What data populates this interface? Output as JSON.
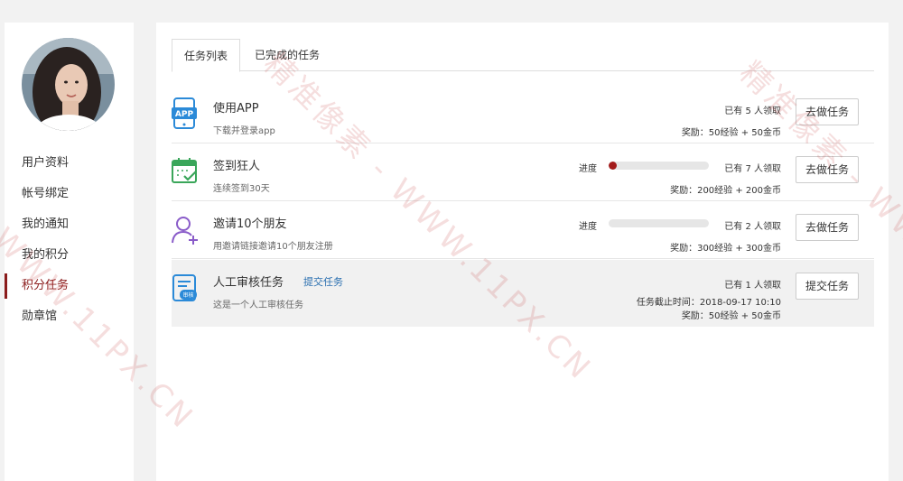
{
  "sidebar": {
    "items": [
      {
        "label": "用户资料"
      },
      {
        "label": "帐号绑定"
      },
      {
        "label": "我的通知"
      },
      {
        "label": "我的积分"
      },
      {
        "label": "积分任务"
      },
      {
        "label": "勋章馆"
      }
    ],
    "active_index": 4
  },
  "tabs": [
    {
      "label": "任务列表"
    },
    {
      "label": "已完成的任务"
    }
  ],
  "tasks": [
    {
      "icon": "app-icon",
      "title": "使用APP",
      "desc": "下载并登录app",
      "claimed": "已有 5 人领取",
      "reward": "奖励：50经验 + 50金币",
      "button": "去做任务"
    },
    {
      "icon": "calendar-check-icon",
      "title": "签到狂人",
      "desc": "连续签到30天",
      "progress_label": "进度",
      "progress": 0.08,
      "claimed": "已有 7 人领取",
      "reward": "奖励：200经验 + 200金币",
      "button": "去做任务"
    },
    {
      "icon": "add-user-icon",
      "title": "邀请10个朋友",
      "desc": "用邀请链接邀请10个朋友注册",
      "progress_label": "进度",
      "progress": 0,
      "claimed": "已有 2 人领取",
      "reward": "奖励：300经验 + 300金币",
      "button": "去做任务"
    },
    {
      "icon": "review-document-icon",
      "icon_text": "审核",
      "title": "人工审核任务",
      "submit_link": "提交任务",
      "desc": "这是一个人工审核任务",
      "claimed": "已有 1 人领取",
      "deadline": "任务截止时间：2018-09-17 10:10",
      "reward": "奖励：50经验 + 50金币",
      "button": "提交任务"
    }
  ],
  "watermarks": [
    "精准像素 - WWW.11PX.CN",
    "精准像素 - WWW.11PX.CN",
    "WWW.11PX.CN"
  ],
  "colors": {
    "accent": "#8b1c1c",
    "progress_fill": "#a31b1b",
    "link": "#2a6fb0",
    "icon_blue": "#2b8ad8",
    "icon_green": "#3aa65a",
    "icon_purple": "#8a5cc9"
  }
}
